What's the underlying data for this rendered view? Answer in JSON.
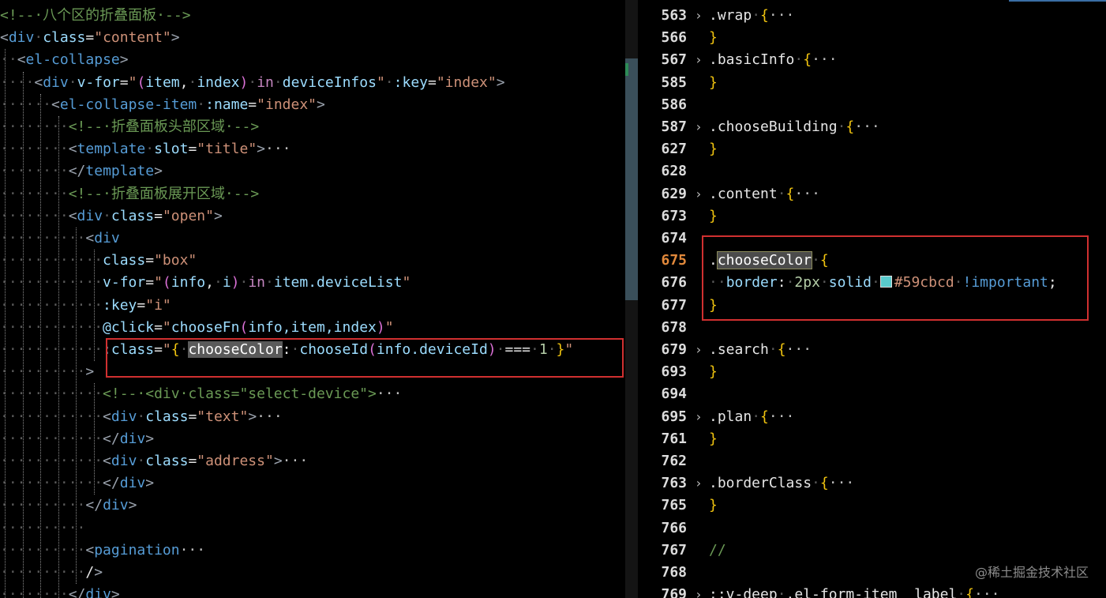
{
  "left": {
    "lines": [
      {
        "indent": 0,
        "parts": [
          [
            "cmt",
            "<!--·八个区的折叠面板·-->"
          ]
        ]
      },
      {
        "indent": 0,
        "parts": [
          [
            "punct",
            "<"
          ],
          [
            "tag",
            "div"
          ],
          [
            "ws",
            "·"
          ],
          [
            "attr",
            "class"
          ],
          [
            "plain",
            "="
          ],
          [
            "str",
            "\"content\""
          ],
          [
            "punct",
            ">"
          ]
        ]
      },
      {
        "indent": 1,
        "parts": [
          [
            "punct",
            "<"
          ],
          [
            "tag",
            "el-collapse"
          ],
          [
            "punct",
            ">"
          ]
        ]
      },
      {
        "indent": 2,
        "parts": [
          [
            "punct",
            "<"
          ],
          [
            "tag",
            "div"
          ],
          [
            "ws",
            "·"
          ],
          [
            "attr",
            "v-for"
          ],
          [
            "plain",
            "="
          ],
          [
            "str",
            "\""
          ],
          [
            "paren",
            "("
          ],
          [
            "attr",
            "item"
          ],
          [
            "plain",
            ","
          ],
          [
            "ws",
            "·"
          ],
          [
            "attr",
            "index"
          ],
          [
            "paren",
            ")"
          ],
          [
            "ws",
            "·"
          ],
          [
            "kw",
            "in"
          ],
          [
            "ws",
            "·"
          ],
          [
            "attr",
            "deviceInfos"
          ],
          [
            "str",
            "\""
          ],
          [
            "ws",
            "·"
          ],
          [
            "attr",
            ":key"
          ],
          [
            "plain",
            "="
          ],
          [
            "str",
            "\"index\""
          ],
          [
            "punct",
            ">"
          ]
        ]
      },
      {
        "indent": 3,
        "parts": [
          [
            "punct",
            "<"
          ],
          [
            "tag",
            "el-collapse-item"
          ],
          [
            "ws",
            "·"
          ],
          [
            "attr",
            ":name"
          ],
          [
            "plain",
            "="
          ],
          [
            "str",
            "\"index\""
          ],
          [
            "punct",
            ">"
          ]
        ]
      },
      {
        "indent": 4,
        "parts": [
          [
            "cmt",
            "<!--·折叠面板头部区域·-->"
          ]
        ]
      },
      {
        "indent": 4,
        "parts": [
          [
            "punct",
            "<"
          ],
          [
            "tag",
            "template"
          ],
          [
            "ws",
            "·"
          ],
          [
            "attr",
            "slot"
          ],
          [
            "plain",
            "="
          ],
          [
            "str",
            "\"title\""
          ],
          [
            "punct",
            ">"
          ],
          [
            "fold",
            "···"
          ]
        ]
      },
      {
        "indent": 4,
        "parts": [
          [
            "punct",
            "</"
          ],
          [
            "tag",
            "template"
          ],
          [
            "punct",
            ">"
          ]
        ]
      },
      {
        "indent": 4,
        "parts": [
          [
            "cmt",
            "<!--·折叠面板展开区域·-->"
          ]
        ]
      },
      {
        "indent": 4,
        "parts": [
          [
            "punct",
            "<"
          ],
          [
            "tag",
            "div"
          ],
          [
            "ws",
            "·"
          ],
          [
            "attr",
            "class"
          ],
          [
            "plain",
            "="
          ],
          [
            "str",
            "\"open\""
          ],
          [
            "punct",
            ">"
          ]
        ]
      },
      {
        "indent": 5,
        "parts": [
          [
            "punct",
            "<"
          ],
          [
            "tag",
            "div"
          ]
        ]
      },
      {
        "indent": 6,
        "parts": [
          [
            "attr",
            "class"
          ],
          [
            "plain",
            "="
          ],
          [
            "str",
            "\"box\""
          ]
        ]
      },
      {
        "indent": 6,
        "parts": [
          [
            "attr",
            "v-for"
          ],
          [
            "plain",
            "="
          ],
          [
            "str",
            "\""
          ],
          [
            "paren",
            "("
          ],
          [
            "attr",
            "info"
          ],
          [
            "plain",
            ","
          ],
          [
            "ws",
            "·"
          ],
          [
            "attr",
            "i"
          ],
          [
            "paren",
            ")"
          ],
          [
            "ws",
            "·"
          ],
          [
            "kw",
            "in"
          ],
          [
            "ws",
            "·"
          ],
          [
            "attr",
            "item.deviceList"
          ],
          [
            "str",
            "\""
          ]
        ]
      },
      {
        "indent": 6,
        "parts": [
          [
            "attr",
            ":key"
          ],
          [
            "plain",
            "="
          ],
          [
            "str",
            "\"i\""
          ]
        ]
      },
      {
        "indent": 6,
        "parts": [
          [
            "attr",
            "@click"
          ],
          [
            "plain",
            "="
          ],
          [
            "str",
            "\""
          ],
          [
            "attr",
            "chooseFn"
          ],
          [
            "paren",
            "("
          ],
          [
            "attr",
            "info,item,index"
          ],
          [
            "paren",
            ")"
          ],
          [
            "str",
            "\""
          ]
        ]
      },
      {
        "indent": 6,
        "parts": [
          [
            "attr",
            ":class"
          ],
          [
            "plain",
            "="
          ],
          [
            "str",
            "\""
          ],
          [
            "brace",
            "{"
          ],
          [
            "ws",
            "·"
          ],
          [
            "hl",
            "chooseColor"
          ],
          [
            "plain",
            ":"
          ],
          [
            "ws",
            "·"
          ],
          [
            "attr",
            "chooseId"
          ],
          [
            "paren",
            "("
          ],
          [
            "attr",
            "info.deviceId"
          ],
          [
            "paren",
            ")"
          ],
          [
            "ws",
            "·"
          ],
          [
            "plain",
            "==="
          ],
          [
            "ws",
            "·"
          ],
          [
            "num",
            "1"
          ],
          [
            "ws",
            "·"
          ],
          [
            "brace",
            "}"
          ],
          [
            "str",
            "\""
          ]
        ]
      },
      {
        "indent": 5,
        "parts": [
          [
            "punct",
            ">"
          ]
        ]
      },
      {
        "indent": 6,
        "parts": [
          [
            "cmt",
            "<!--·<div·class=\"select-device\">"
          ],
          [
            "fold",
            "···"
          ]
        ]
      },
      {
        "indent": 6,
        "parts": [
          [
            "punct",
            "<"
          ],
          [
            "tag",
            "div"
          ],
          [
            "ws",
            "·"
          ],
          [
            "attr",
            "class"
          ],
          [
            "plain",
            "="
          ],
          [
            "str",
            "\"text\""
          ],
          [
            "punct",
            ">"
          ],
          [
            "fold",
            "···"
          ]
        ]
      },
      {
        "indent": 6,
        "parts": [
          [
            "punct",
            "</"
          ],
          [
            "tag",
            "div"
          ],
          [
            "punct",
            ">"
          ]
        ]
      },
      {
        "indent": 6,
        "parts": [
          [
            "punct",
            "<"
          ],
          [
            "tag",
            "div"
          ],
          [
            "ws",
            "·"
          ],
          [
            "attr",
            "class"
          ],
          [
            "plain",
            "="
          ],
          [
            "str",
            "\"address\""
          ],
          [
            "punct",
            ">"
          ],
          [
            "fold",
            "···"
          ]
        ]
      },
      {
        "indent": 6,
        "parts": [
          [
            "punct",
            "</"
          ],
          [
            "tag",
            "div"
          ],
          [
            "punct",
            ">"
          ]
        ]
      },
      {
        "indent": 5,
        "parts": [
          [
            "punct",
            "</"
          ],
          [
            "tag",
            "div"
          ],
          [
            "punct",
            ">"
          ]
        ]
      },
      {
        "indent": 5,
        "parts": []
      },
      {
        "indent": 5,
        "parts": [
          [
            "punct",
            "<"
          ],
          [
            "tag",
            "pagination"
          ],
          [
            "fold",
            "···"
          ]
        ]
      },
      {
        "indent": 5,
        "parts": [
          [
            "plain",
            "/"
          ],
          [
            "punct",
            ">"
          ]
        ]
      },
      {
        "indent": 4,
        "parts": [
          [
            "punct",
            "</"
          ],
          [
            "tag",
            "div"
          ],
          [
            "punct",
            ">"
          ]
        ]
      }
    ]
  },
  "right": {
    "lines": [
      {
        "num": "563",
        "fold": true,
        "parts": [
          [
            "sel",
            ".wrap"
          ],
          [
            "ws",
            "·"
          ],
          [
            "brace",
            "{"
          ],
          [
            "fold",
            "···"
          ]
        ]
      },
      {
        "num": "566",
        "fold": false,
        "parts": [
          [
            "brace",
            "}"
          ]
        ]
      },
      {
        "num": "567",
        "fold": true,
        "parts": [
          [
            "sel",
            ".basicInfo"
          ],
          [
            "ws",
            "·"
          ],
          [
            "brace",
            "{"
          ],
          [
            "fold",
            "···"
          ]
        ]
      },
      {
        "num": "585",
        "fold": false,
        "parts": [
          [
            "brace",
            "}"
          ]
        ]
      },
      {
        "num": "586",
        "fold": false,
        "parts": []
      },
      {
        "num": "587",
        "fold": true,
        "parts": [
          [
            "sel",
            ".chooseBuilding"
          ],
          [
            "ws",
            "·"
          ],
          [
            "brace",
            "{"
          ],
          [
            "fold",
            "···"
          ]
        ]
      },
      {
        "num": "627",
        "fold": false,
        "parts": [
          [
            "brace",
            "}"
          ]
        ]
      },
      {
        "num": "628",
        "fold": false,
        "parts": []
      },
      {
        "num": "629",
        "fold": true,
        "parts": [
          [
            "sel",
            ".content"
          ],
          [
            "ws",
            "·"
          ],
          [
            "brace",
            "{"
          ],
          [
            "fold",
            "···"
          ]
        ]
      },
      {
        "num": "673",
        "fold": false,
        "parts": [
          [
            "brace",
            "}"
          ]
        ]
      },
      {
        "num": "674",
        "fold": false,
        "parts": []
      },
      {
        "num": "675",
        "fold": false,
        "active": true,
        "parts": [
          [
            "sel",
            "."
          ],
          [
            "hl2",
            "chooseColor"
          ],
          [
            "ws",
            "·"
          ],
          [
            "brace",
            "{"
          ]
        ]
      },
      {
        "num": "676",
        "fold": false,
        "parts": [
          [
            "ws",
            "··"
          ],
          [
            "prop",
            "border"
          ],
          [
            "plain",
            ":"
          ],
          [
            "ws",
            "·"
          ],
          [
            "num",
            "2px"
          ],
          [
            "ws",
            "·"
          ],
          [
            "prop",
            "solid"
          ],
          [
            "ws",
            "·"
          ],
          [
            "swatch",
            ""
          ],
          [
            "str",
            "#59cbcd"
          ],
          [
            "ws",
            "·"
          ],
          [
            "tag",
            "!important"
          ],
          [
            "plain",
            ";"
          ]
        ]
      },
      {
        "num": "677",
        "fold": false,
        "parts": [
          [
            "brace",
            "}"
          ]
        ]
      },
      {
        "num": "678",
        "fold": false,
        "parts": []
      },
      {
        "num": "679",
        "fold": true,
        "parts": [
          [
            "sel",
            ".search"
          ],
          [
            "ws",
            "·"
          ],
          [
            "brace",
            "{"
          ],
          [
            "fold",
            "···"
          ]
        ]
      },
      {
        "num": "693",
        "fold": false,
        "parts": [
          [
            "brace",
            "}"
          ]
        ]
      },
      {
        "num": "694",
        "fold": false,
        "parts": []
      },
      {
        "num": "695",
        "fold": true,
        "parts": [
          [
            "sel",
            ".plan"
          ],
          [
            "ws",
            "·"
          ],
          [
            "brace",
            "{"
          ],
          [
            "fold",
            "···"
          ]
        ]
      },
      {
        "num": "761",
        "fold": false,
        "parts": [
          [
            "brace",
            "}"
          ]
        ]
      },
      {
        "num": "762",
        "fold": false,
        "parts": []
      },
      {
        "num": "763",
        "fold": true,
        "parts": [
          [
            "sel",
            ".borderClass"
          ],
          [
            "ws",
            "·"
          ],
          [
            "brace",
            "{"
          ],
          [
            "fold",
            "···"
          ]
        ]
      },
      {
        "num": "765",
        "fold": false,
        "parts": [
          [
            "brace",
            "}"
          ]
        ]
      },
      {
        "num": "766",
        "fold": false,
        "parts": []
      },
      {
        "num": "767",
        "fold": false,
        "parts": [
          [
            "cmt",
            "//"
          ]
        ]
      },
      {
        "num": "768",
        "fold": false,
        "parts": []
      },
      {
        "num": "769",
        "fold": true,
        "parts": [
          [
            "sel",
            "::v-deep"
          ],
          [
            "ws",
            "·"
          ],
          [
            "sel",
            ".el-form-item__label"
          ],
          [
            "ws",
            "·"
          ],
          [
            "brace",
            "{"
          ],
          [
            "fold",
            "···"
          ]
        ]
      }
    ]
  },
  "watermark": "@稀土掘金技术社区",
  "colors": {
    "swatch": "#59cbcd",
    "highlight_box": "#d03030"
  }
}
